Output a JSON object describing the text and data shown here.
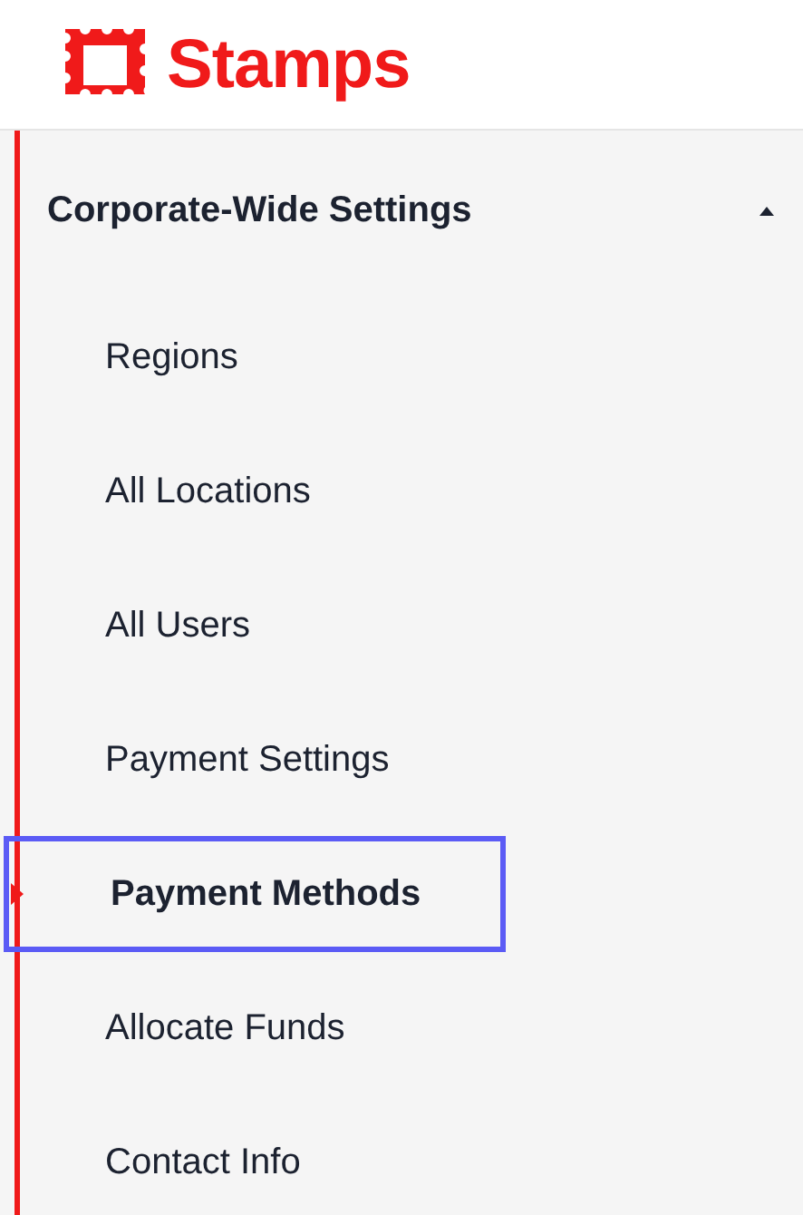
{
  "logo": {
    "text": "Stamps"
  },
  "section": {
    "title": "Corporate-Wide Settings",
    "expanded": true
  },
  "items": [
    {
      "label": "Regions",
      "selected": false
    },
    {
      "label": "All Locations",
      "selected": false
    },
    {
      "label": "All Users",
      "selected": false
    },
    {
      "label": "Payment Settings",
      "selected": false
    },
    {
      "label": "Payment Methods",
      "selected": true
    },
    {
      "label": "Allocate Funds",
      "selected": false
    },
    {
      "label": "Contact Info",
      "selected": false
    }
  ]
}
